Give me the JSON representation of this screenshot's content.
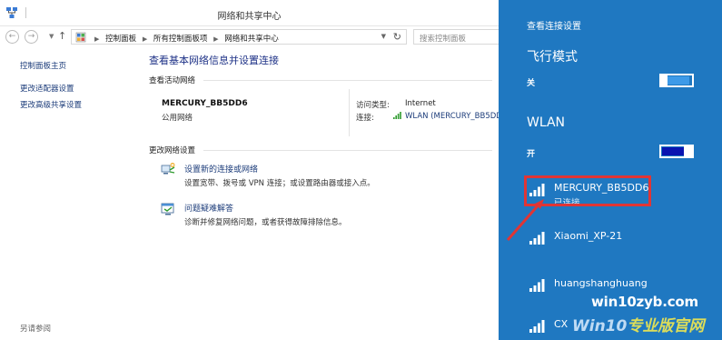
{
  "window": {
    "title": "网络和共享中心"
  },
  "address_bar": {
    "crumbs": [
      "控制面板",
      "所有控制面板项",
      "网络和共享中心"
    ],
    "search_placeholder": "搜索控制面板"
  },
  "sidebar": {
    "home": "控制面板主页",
    "links": [
      "更改适配器设置",
      "更改高级共享设置"
    ],
    "see_also": "另请参阅"
  },
  "main": {
    "heading": "查看基本网络信息并设置连接",
    "active_label": "查看活动网络",
    "network_name": "MERCURY_BB5DD6",
    "network_type": "公用网络",
    "access_type_label": "访问类型:",
    "access_type_value": "Internet",
    "connection_label": "连接:",
    "connection_value": "WLAN (MERCURY_BB5DD6)",
    "change_label": "更改网络设置",
    "tasks": [
      {
        "title": "设置新的连接或网络",
        "desc": "设置宽带、拨号或 VPN 连接；或设置路由器或接入点。",
        "icon": "new-connection-icon"
      },
      {
        "title": "问题疑难解答",
        "desc": "诊断并修复网络问题，或者获得故障排除信息。",
        "icon": "troubleshoot-icon"
      }
    ]
  },
  "panel": {
    "header": "查看连接设置",
    "airplane": {
      "title": "飞行模式",
      "state": "关"
    },
    "wlan": {
      "title": "WLAN",
      "state": "开"
    },
    "networks": [
      {
        "ssid": "MERCURY_BB5DD6",
        "status": "已连接"
      },
      {
        "ssid": "Xiaomi_XP-21",
        "status": ""
      },
      {
        "ssid": "huangshanghuang",
        "status": ""
      },
      {
        "ssid": "CX",
        "status": ""
      }
    ],
    "colors": {
      "background": "#1f78c1",
      "toggle_on": "#0a14b0",
      "toggle_off": "#3d9ae8",
      "highlight": "#e03535"
    }
  },
  "watermark": {
    "line1": "win10zyb.com",
    "line2_a": "Win10",
    "line2_b": "专业版官网"
  }
}
